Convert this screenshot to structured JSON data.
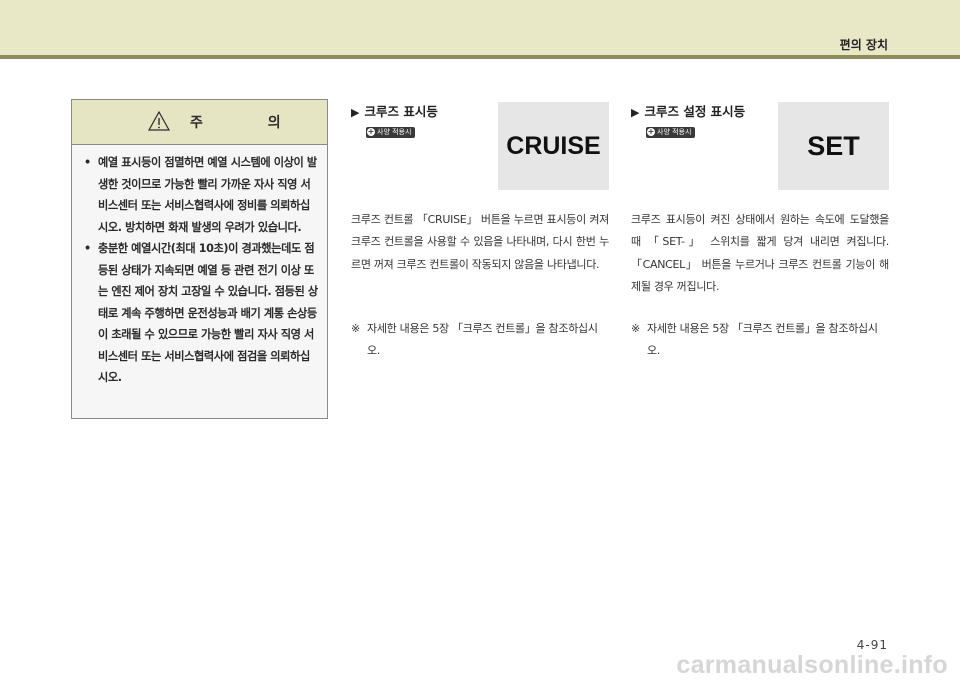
{
  "header": {
    "section_title": "편의 장치"
  },
  "caution": {
    "title": "주 의",
    "icon": "warning-triangle-icon",
    "items": [
      "예열 표시등이 점멸하면 예열 시스템에 이상이 발생한 것이므로 가능한 빨리 가까운 자사 직영 서비스센터 또는 서비스협력사에 정비를 의뢰하십시오. 방치하면 화재 발생의 우려가 있습니다.",
      "충분한 예열시간(최대 10초)이 경과했는데도 점등된 상태가 지속되면 예열 등 관련 전기 이상 또는 엔진 제어 장치 고장일 수 있습니다. 점등된 상태로 계속 주행하면 운전성능과 배기 계통 손상등이 초래될 수 있으므로 가능한 빨리 자사 직영 서비스센터 또는 서비스협력사에 점검을 의뢰하십시오."
    ]
  },
  "cruise": {
    "heading": "크루즈 표시등",
    "badge": "사양 적용시",
    "indicator_text": "CRUISE",
    "body": "크루즈 컨트롤 「CRUISE」 버튼을 누르면 표시등이 켜져 크루즈 컨트롤을 사용할 수 있음을 나타내며, 다시 한번 누르면 꺼져 크루즈 컨트롤이 작동되지 않음을 나타냅니다.",
    "note_mark": "※",
    "note": "자세한 내용은 5장 「크루즈 컨트롤」을 참조하십시오."
  },
  "cruise_set": {
    "heading": "크루즈 설정 표시등",
    "badge": "사양 적용시",
    "indicator_text": "SET",
    "body": "크루즈 표시등이 켜진 상태에서 원하는 속도에 도달했을 때 「SET-」 스위치를 짧게 당겨 내리면 켜집니다. 「CANCEL」 버튼을 누르거나 크루즈 컨트롤 기능이 해제될 경우 꺼집니다.",
    "note_mark": "※",
    "note": "자세한 내용은 5장 「크루즈 컨트롤」을 참조하십시오."
  },
  "page_number": "4-91",
  "watermark": "carmanualsonline.info"
}
